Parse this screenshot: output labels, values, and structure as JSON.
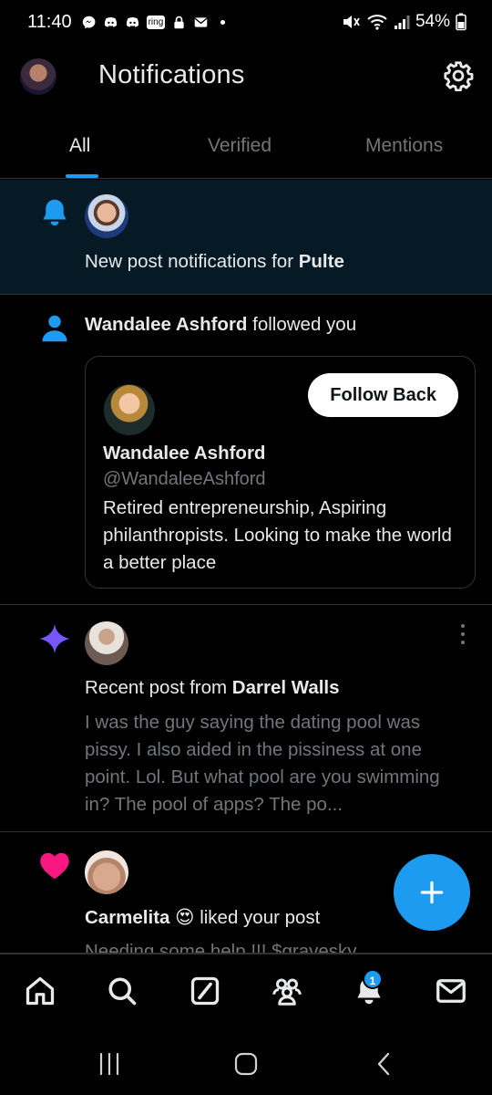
{
  "status_bar": {
    "time": "11:40",
    "ring_label": "ring",
    "battery": "54%"
  },
  "header": {
    "title": "Notifications"
  },
  "tabs": [
    {
      "label": "All",
      "active": true
    },
    {
      "label": "Verified",
      "active": false
    },
    {
      "label": "Mentions",
      "active": false
    }
  ],
  "notifications": [
    {
      "type": "new-post-subscription",
      "icon": "bell-icon",
      "text_prefix": "New post notifications for ",
      "name": "Pulte"
    },
    {
      "type": "follow",
      "icon": "person-icon",
      "name": "Wandalee Ashford",
      "text_suffix": " followed you",
      "card": {
        "name": "Wandalee Ashford",
        "handle": "@WandaleeAshford",
        "bio": "Retired entrepreneurship, Aspiring philanthropists. Looking to make the world a better place",
        "button_label": "Follow Back"
      }
    },
    {
      "type": "recent-post",
      "icon": "sparkle-icon",
      "text_prefix": "Recent post from ",
      "name": "Darrel Walls",
      "preview": "I was the guy saying the dating pool was pissy. I also aided in the pissiness at one point. Lol. But what pool are you swimming in? The pool of apps? The po..."
    },
    {
      "type": "like",
      "icon": "heart-icon",
      "name": "Carmelita 😍",
      "text_suffix": " liked your post",
      "preview": "Needing some help !!! $gravesky"
    }
  ],
  "bottom_nav": {
    "items": [
      "home-icon",
      "search-icon",
      "grok-icon",
      "communities-icon",
      "bell-icon",
      "mail-icon"
    ],
    "notification_badge": "1"
  },
  "colors": {
    "accent": "#1d9bf0",
    "background": "#000000",
    "highlight_row": "#061a25",
    "sparkle": "#7856ff",
    "heart": "#f91880",
    "muted_text": "#71767b"
  }
}
